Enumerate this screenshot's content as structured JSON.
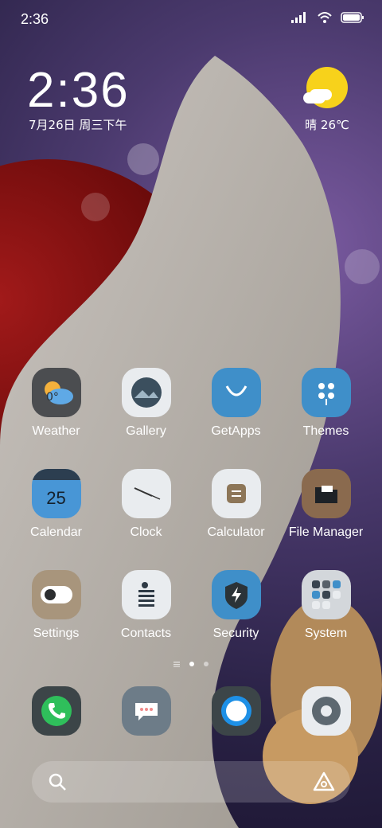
{
  "status_bar": {
    "time": "2:36"
  },
  "lock_widget": {
    "clock": "2:36",
    "date": "7月26日 周三下午",
    "weather": "晴 26℃"
  },
  "apps": [
    [
      {
        "label": "Weather"
      },
      {
        "label": "Gallery"
      },
      {
        "label": "GetApps"
      },
      {
        "label": "Themes"
      }
    ],
    [
      {
        "label": "Calendar",
        "day": "25"
      },
      {
        "label": "Clock"
      },
      {
        "label": "Calculator"
      },
      {
        "label": "File Manager"
      }
    ],
    [
      {
        "label": "Settings"
      },
      {
        "label": "Contacts"
      },
      {
        "label": "Security"
      },
      {
        "label": "System"
      }
    ]
  ],
  "weather_icon_text": "0°",
  "page_indicator": {
    "pages": 2,
    "current": 1
  }
}
